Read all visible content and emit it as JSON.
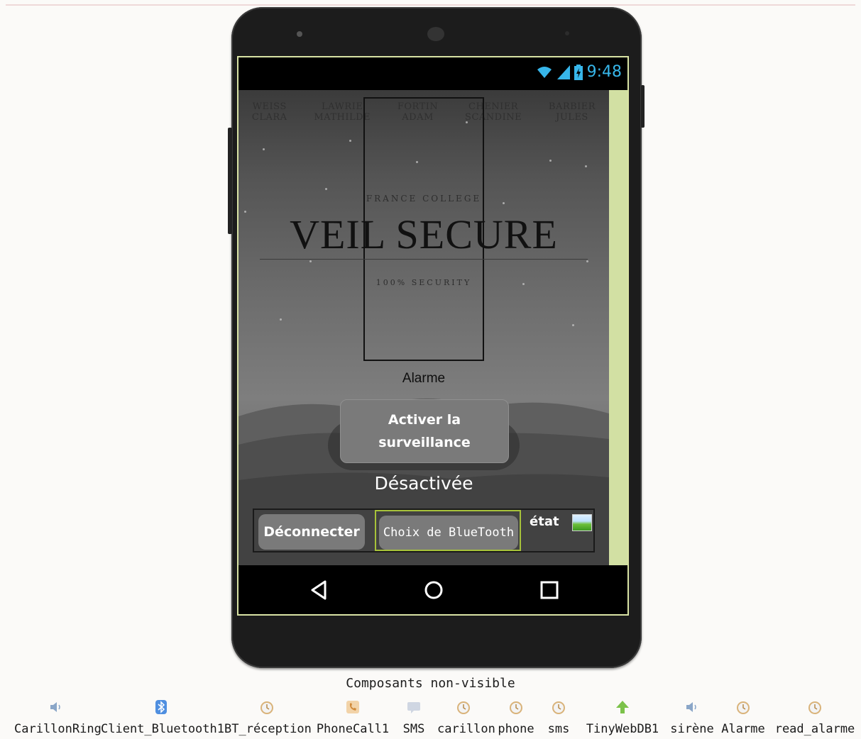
{
  "status_bar": {
    "time": "9:48"
  },
  "app": {
    "names": [
      [
        "WEISS",
        "CLARA"
      ],
      [
        "LAWRIE",
        "MATHILDE"
      ],
      [
        "FORTIN",
        "ADAM"
      ],
      [
        "CHENIER",
        "SCANDINE"
      ],
      [
        "BARBIER",
        "JULES"
      ]
    ],
    "logo": {
      "college": "FRANCE COLLEGE",
      "title": "VEIL SECURE",
      "tagline": "100% SECURITY"
    },
    "alarm_label": "Alarme",
    "activate_button": [
      "Activer la",
      "surveillance"
    ],
    "state_text": "Désactivée",
    "disconnect_button": "Déconnecter",
    "bluetooth_button": "Choix de BlueTooth",
    "etat_label": "état"
  },
  "non_visible": {
    "title": "Composants non-visible",
    "components": [
      {
        "name": "CarillonRing",
        "icon": "speaker-icon"
      },
      {
        "name": "Client_Bluetooth1",
        "icon": "bluetooth-icon"
      },
      {
        "name": "BT_réception",
        "icon": "clock-icon"
      },
      {
        "name": "PhoneCall1",
        "icon": "phone-icon"
      },
      {
        "name": "SMS",
        "icon": "message-icon"
      },
      {
        "name": "carillon",
        "icon": "clock-icon"
      },
      {
        "name": "phone",
        "icon": "clock-icon"
      },
      {
        "name": "sms",
        "icon": "clock-icon"
      },
      {
        "name": "TinyWebDB1",
        "icon": "upload-arrow-icon"
      },
      {
        "name": "sirène",
        "icon": "speaker-icon"
      },
      {
        "name": "Alarme",
        "icon": "clock-icon"
      },
      {
        "name": "read_alarme",
        "icon": "clock-icon"
      }
    ]
  }
}
